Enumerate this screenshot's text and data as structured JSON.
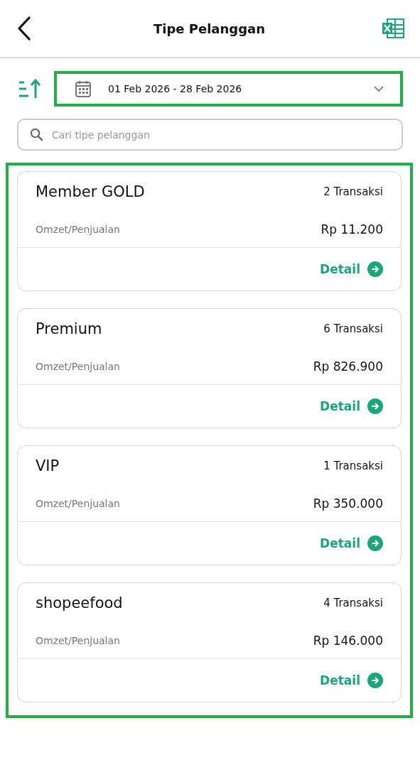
{
  "header": {
    "title": "Tipe Pelanggan"
  },
  "date_range": {
    "value": "01 Feb 2026 - 28 Feb 2026"
  },
  "search": {
    "placeholder": "Cari tipe pelanggan"
  },
  "customer_types": [
    {
      "name": "Member GOLD",
      "transactions": "2 Transaksi",
      "revenue_label": "Omzet/Penjualan",
      "revenue": "Rp 11.200",
      "action": "Detail"
    },
    {
      "name": "Premium",
      "transactions": "6 Transaksi",
      "revenue_label": "Omzet/Penjualan",
      "revenue": "Rp 826.900",
      "action": "Detail"
    },
    {
      "name": "VIP",
      "transactions": "1 Transaksi",
      "revenue_label": "Omzet/Penjualan",
      "revenue": "Rp 350.000",
      "action": "Detail"
    },
    {
      "name": "shopeefood",
      "transactions": "4 Transaksi",
      "revenue_label": "Omzet/Penjualan",
      "revenue": "Rp 146.000",
      "action": "Detail"
    }
  ]
}
